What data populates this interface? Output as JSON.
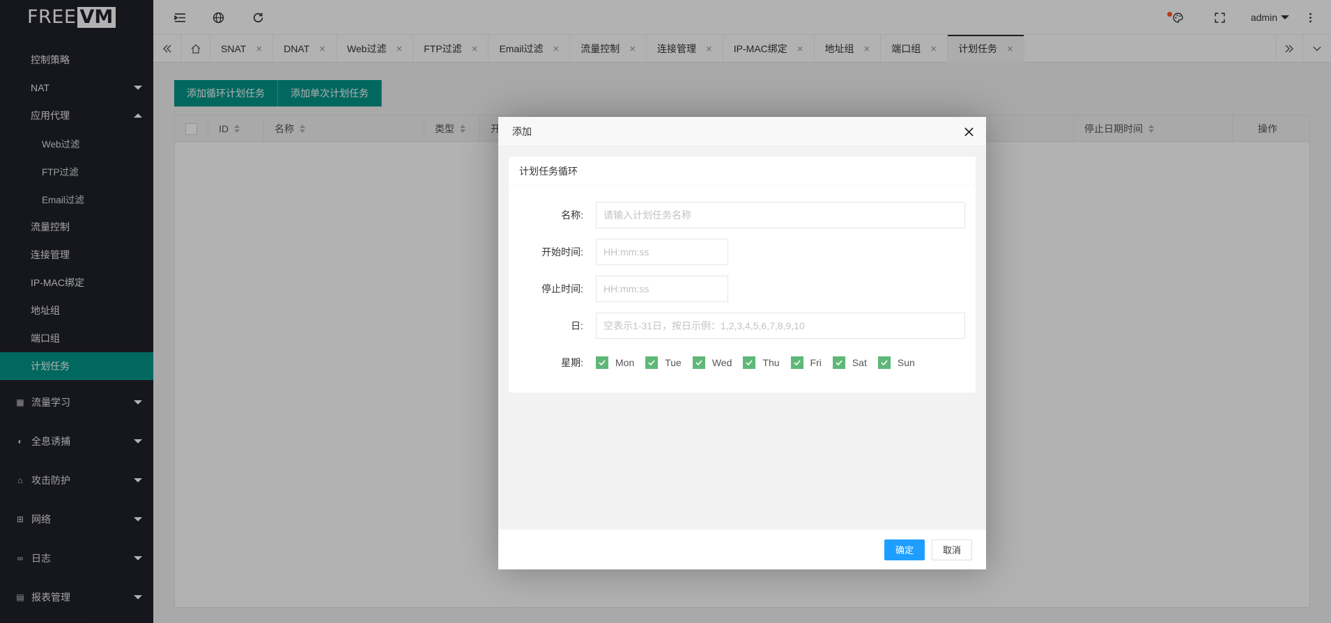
{
  "logo": {
    "part1": "FREE",
    "part2": "VM"
  },
  "sidebar": {
    "items": [
      {
        "label": "控制策略"
      },
      {
        "label": "NAT"
      },
      {
        "label": "应用代理"
      },
      {
        "label": "Web过滤"
      },
      {
        "label": "FTP过滤"
      },
      {
        "label": "Email过滤"
      },
      {
        "label": "流量控制"
      },
      {
        "label": "连接管理"
      },
      {
        "label": "IP-MAC绑定"
      },
      {
        "label": "地址组"
      },
      {
        "label": "端口组"
      },
      {
        "label": "计划任务"
      }
    ],
    "groups": [
      {
        "label": "流量学习",
        "icon": "traffic-learning-icon"
      },
      {
        "label": "全息诱捕",
        "icon": "honeypot-icon"
      },
      {
        "label": "攻击防护",
        "icon": "shield-icon"
      },
      {
        "label": "网络",
        "icon": "network-icon"
      },
      {
        "label": "日志",
        "icon": "log-icon"
      },
      {
        "label": "报表管理",
        "icon": "report-icon"
      }
    ]
  },
  "header": {
    "user": "admin"
  },
  "tabs": [
    {
      "label": "SNAT"
    },
    {
      "label": "DNAT"
    },
    {
      "label": "Web过滤"
    },
    {
      "label": "FTP过滤"
    },
    {
      "label": "Email过滤"
    },
    {
      "label": "流量控制"
    },
    {
      "label": "连接管理"
    },
    {
      "label": "IP-MAC绑定"
    },
    {
      "label": "地址组"
    },
    {
      "label": "端口组"
    },
    {
      "label": "计划任务"
    }
  ],
  "toolbar": {
    "add_loop": "添加循环计划任务",
    "add_once": "添加单次计划任务"
  },
  "table": {
    "columns": [
      "ID",
      "名称",
      "类型",
      "开",
      "停止日期时间",
      "操作"
    ]
  },
  "modal": {
    "title": "添加",
    "section_title": "计划任务循环",
    "name_label": "名称:",
    "name_placeholder": "请输入计划任务名称",
    "start_label": "开始时间:",
    "start_placeholder": "HH:mm:ss",
    "stop_label": "停止时间:",
    "stop_placeholder": "HH:mm:ss",
    "day_label": "日:",
    "day_placeholder": "空表示1-31日，按日示例：1,2,3,4,5,6,7,8,9,10",
    "week_label": "星期:",
    "weekdays": [
      "Mon",
      "Tue",
      "Wed",
      "Thu",
      "Fri",
      "Sat",
      "Sun"
    ],
    "confirm": "确定",
    "cancel": "取消"
  },
  "colors": {
    "accent": "#009688",
    "sidebar_bg": "#20222a",
    "primary_button": "#1e9fff",
    "checkbox": "#5fb878"
  }
}
